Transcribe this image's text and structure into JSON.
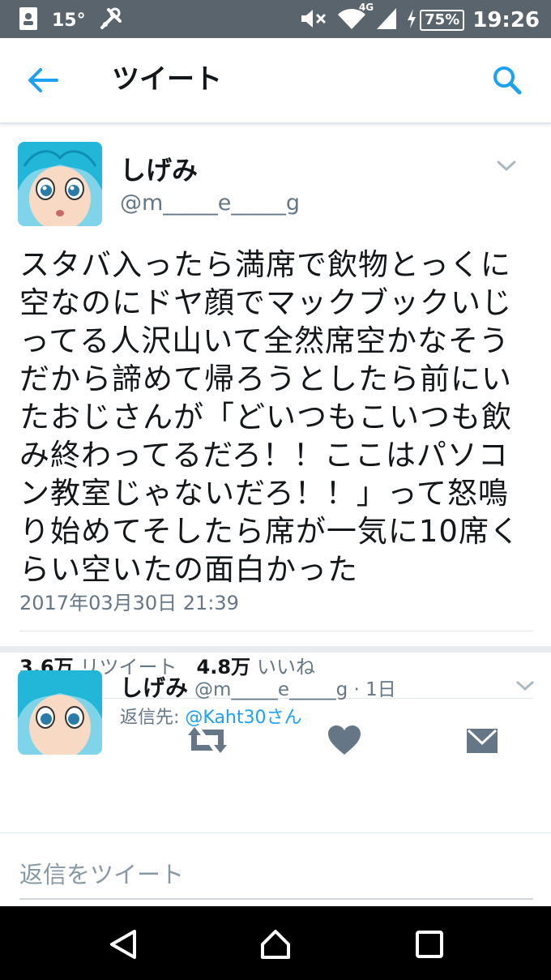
{
  "status_bar": {
    "temperature": "15°",
    "network": "4G",
    "battery": "75%",
    "time": "19:26"
  },
  "header": {
    "title": "ツイート"
  },
  "tweet": {
    "author_name": "しげみ",
    "author_handle": "@m_____e_____g",
    "text": "スタバ入ったら満席で飲物とっくに空なのにドヤ顔でマックブックいじってる人沢山いて全然席空かなそうだから諦めて帰ろうとしたら前にいたおじさんが「どいつもこいつも飲み終わってるだろ！！ここはパソコン教室じゃないだろ！！」って怒鳴り始めてそしたら席が一気に10席くらい空いたの面白かった",
    "date": "2017年03月30日 21:39",
    "retweet_count": "3.6万",
    "retweet_label": "リツイート",
    "like_count": "4.8万",
    "like_label": "いいね"
  },
  "reply": {
    "author_name": "しげみ",
    "meta": "@m_____e_____g · 1日",
    "reply_to_prefix": "返信先: ",
    "reply_to_mention": "@Kaht30さん"
  },
  "compose": {
    "placeholder": "返信をツイート"
  },
  "colors": {
    "accent": "#1da1f2",
    "secondary_text": "#657786",
    "action_icon": "#657786",
    "status_bar": "#5a646c"
  }
}
